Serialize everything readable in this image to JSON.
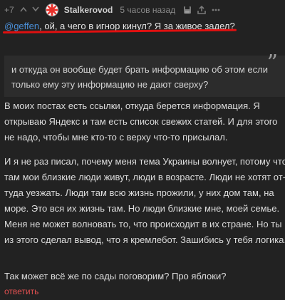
{
  "comment": {
    "rating": "+7",
    "author": "Stalkerovod",
    "time": "5 часов назад",
    "mention": "@geffen",
    "text_after_mention": ", ой, а чего в игнор кинул? Я за живое задел?",
    "quote_line1": "и откуда он вообще будет брать информацию об этом если",
    "quote_line2": "только ему эту информацию не дают сверху?",
    "paragraph1": "В моих постах есть ссылки, откуда берется информация. Я открываю Яндекс и там есть список свежих статей. И для этого не надо, чтобы мне кто-то с верху что-то присылал.",
    "paragraph2": "И я не раз писал, почему меня тема Украины волнует, потому что там мои близкие люди живут, люди в возрасте. Люди не хотят от-туда уезжать. Люди там всю жизнь прожили, у них дом там, на море. Это вся их жизнь там. Но люди близкие мне, моей семье. Меня не может волновать то, что происходит в их стране. Но ты из этого сделал вывод, что я кремлебот. Зашибись у тебя логика.",
    "paragraph3": "Так может всё же по сады поговорим? Про яблоки?",
    "reply_label": "ответить"
  },
  "colors": {
    "background": "#222222",
    "mention": "#4a8fd8",
    "reply_link": "#e05050",
    "underline": "#e01010"
  },
  "icons": [
    "upvote-icon",
    "downvote-icon",
    "avatar-icon",
    "save-icon",
    "share-icon",
    "more-icon",
    "quote-icon"
  ]
}
